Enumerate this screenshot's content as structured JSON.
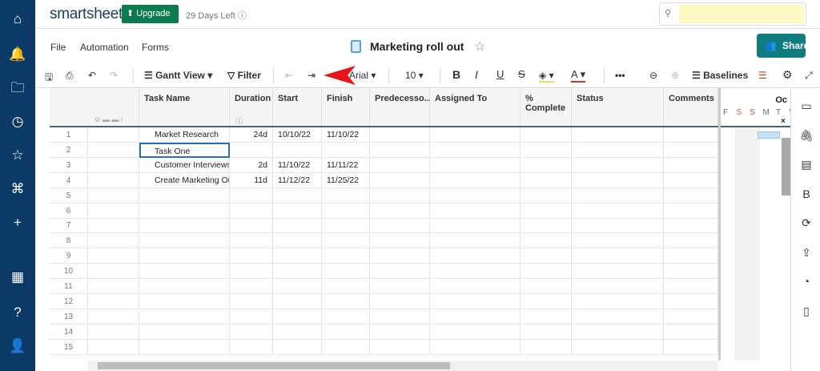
{
  "app": {
    "logo": "smartsheet",
    "upgrade": "Upgrade",
    "trial": "29 Days Left",
    "search_placeholder": ""
  },
  "nav": {
    "icons": [
      "home-icon",
      "bell-icon",
      "folder-icon",
      "clock-icon",
      "star-icon",
      "solutions-icon",
      "plus-icon",
      "apps-grid-icon",
      "help-icon",
      "user-icon"
    ]
  },
  "menu": {
    "file": "File",
    "automation": "Automation",
    "forms": "Forms"
  },
  "sheet": {
    "title": "Marketing roll out",
    "share": "Share"
  },
  "toolbar": {
    "view": "Gantt View",
    "filter": "Filter",
    "font": "Arial",
    "size": "10",
    "baselines": "Baselines"
  },
  "columns": [
    "Task Name",
    "Duration",
    "Start",
    "Finish",
    "Predecesso...",
    "Assigned To",
    "% Complete",
    "Status",
    "Comments"
  ],
  "rows": [
    {
      "n": "1",
      "task": "Market Research",
      "duration": "24d",
      "start": "10/10/22",
      "finish": "11/10/22"
    },
    {
      "n": "2",
      "task": "Task One",
      "duration": "",
      "start": "",
      "finish": ""
    },
    {
      "n": "3",
      "task": "Customer Interviews",
      "duration": "2d",
      "start": "11/10/22",
      "finish": "11/11/22"
    },
    {
      "n": "4",
      "task": "Create Marketing Ou",
      "duration": "11d",
      "start": "11/12/22",
      "finish": "11/25/22"
    },
    {
      "n": "5"
    },
    {
      "n": "6"
    },
    {
      "n": "7"
    },
    {
      "n": "8"
    },
    {
      "n": "9"
    },
    {
      "n": "10"
    },
    {
      "n": "11"
    },
    {
      "n": "12"
    },
    {
      "n": "13"
    },
    {
      "n": "14"
    },
    {
      "n": "15"
    }
  ],
  "gantt": {
    "month": "Oc",
    "days": [
      "F",
      "S",
      "S",
      "M",
      "T",
      "V"
    ],
    "weekend_color": "#d9534f",
    "bar_color": "#c5e3f6"
  },
  "colors": {
    "nav": "#0b3a66",
    "upgrade": "#0b7a4e",
    "share": "#0f7d80"
  }
}
